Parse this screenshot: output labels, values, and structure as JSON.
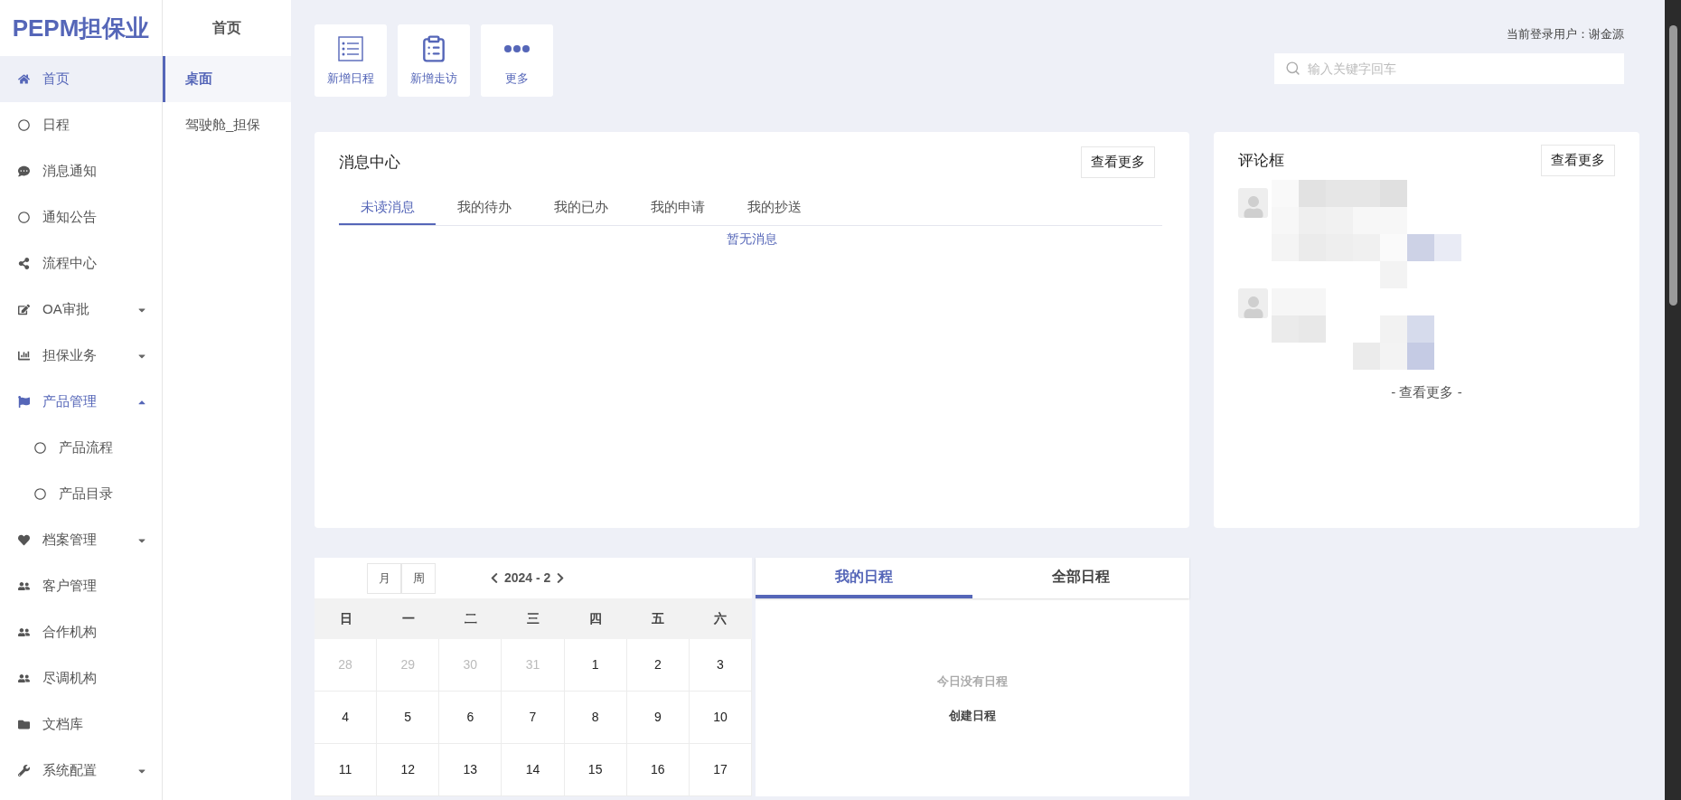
{
  "logo": {
    "text": "PEPM担保业"
  },
  "sidebar": {
    "items": [
      {
        "kind": "link",
        "label": "首页",
        "selected": true
      },
      {
        "kind": "link",
        "label": "日程",
        "selected": false
      },
      {
        "kind": "link",
        "label": "消息通知",
        "selected": false
      },
      {
        "kind": "link",
        "label": "通知公告",
        "selected": false
      },
      {
        "kind": "link",
        "label": "流程中心",
        "selected": false
      },
      {
        "kind": "group",
        "label": "OA审批",
        "selected": false,
        "expanded": false
      },
      {
        "kind": "group",
        "label": "担保业务",
        "selected": false,
        "expanded": false
      },
      {
        "kind": "group",
        "label": "产品管理",
        "selected": false,
        "expanded": true,
        "children": [
          {
            "label": "产品流程",
            "selected": false
          },
          {
            "label": "产品目录",
            "selected": false
          }
        ]
      },
      {
        "kind": "group",
        "label": "档案管理",
        "selected": false,
        "expanded": false
      },
      {
        "kind": "link",
        "label": "客户管理",
        "selected": false
      },
      {
        "kind": "link",
        "label": "合作机构",
        "selected": false
      },
      {
        "kind": "link",
        "label": "尽调机构",
        "selected": false
      },
      {
        "kind": "link",
        "label": "文档库",
        "selected": false
      },
      {
        "kind": "group",
        "label": "系统配置",
        "selected": false,
        "expanded": false
      }
    ]
  },
  "subnav": {
    "title": "首页",
    "items": [
      {
        "label": "桌面",
        "selected": true
      },
      {
        "label": "驾驶舱_担保",
        "selected": false
      }
    ]
  },
  "quick_actions": [
    {
      "kind": "schedule",
      "label": "新增日程"
    },
    {
      "kind": "visit",
      "label": "新增走访"
    },
    {
      "kind": "more",
      "label": "更多"
    }
  ],
  "header": {
    "user_label": "当前登录用户：谢金源",
    "search": {
      "placeholder": "输入关键字回车"
    }
  },
  "message_center": {
    "title": "消息中心",
    "more_button": "查看更多",
    "tabs": [
      {
        "label": "未读消息",
        "selected": true
      },
      {
        "label": "我的待办",
        "selected": false
      },
      {
        "label": "我的已办",
        "selected": false
      },
      {
        "label": "我的申请",
        "selected": false
      },
      {
        "label": "我的抄送",
        "selected": false
      }
    ],
    "empty_text": "暂无消息"
  },
  "comments": {
    "title": "评论框",
    "more_button": "查看更多",
    "footer_link": "- 查看更多 -"
  },
  "calendar": {
    "view_buttons": [
      "月",
      "周"
    ],
    "month_label": "2024 - 2",
    "weekdays": [
      "日",
      "一",
      "二",
      "三",
      "四",
      "五",
      "六"
    ],
    "weeks": [
      [
        {
          "day": "28",
          "outside": true
        },
        {
          "day": "29",
          "outside": true
        },
        {
          "day": "30",
          "outside": true
        },
        {
          "day": "31",
          "outside": true
        },
        {
          "day": "1",
          "outside": false
        },
        {
          "day": "2",
          "outside": false
        },
        {
          "day": "3",
          "outside": false
        }
      ],
      [
        {
          "day": "4",
          "outside": false
        },
        {
          "day": "5",
          "outside": false
        },
        {
          "day": "6",
          "outside": false
        },
        {
          "day": "7",
          "outside": false
        },
        {
          "day": "8",
          "outside": false
        },
        {
          "day": "9",
          "outside": false
        },
        {
          "day": "10",
          "outside": false
        }
      ],
      [
        {
          "day": "11",
          "outside": false
        },
        {
          "day": "12",
          "outside": false
        },
        {
          "day": "13",
          "outside": false
        },
        {
          "day": "14",
          "outside": false
        },
        {
          "day": "15",
          "outside": false
        },
        {
          "day": "16",
          "outside": false
        },
        {
          "day": "17",
          "outside": false
        }
      ]
    ]
  },
  "schedule": {
    "tabs": [
      {
        "label": "我的日程",
        "selected": true
      },
      {
        "label": "全部日程",
        "selected": false
      }
    ],
    "empty_text": "今日没有日程",
    "create_button": "创建日程"
  }
}
